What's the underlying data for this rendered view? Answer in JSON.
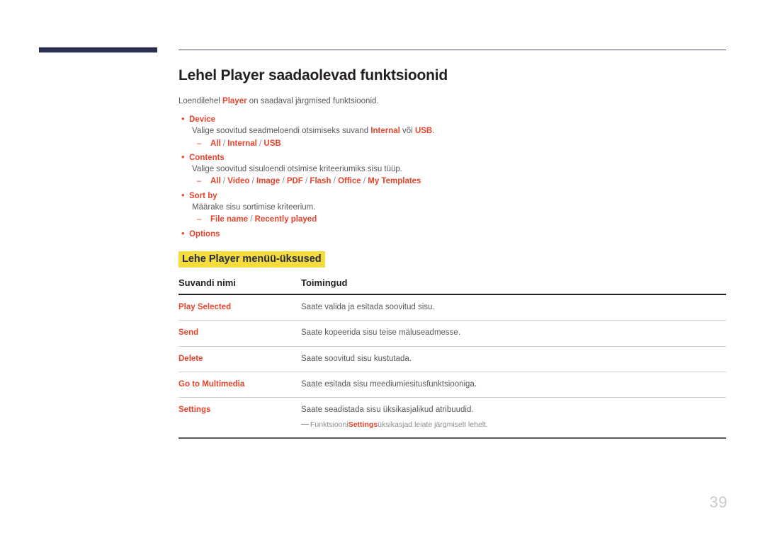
{
  "page": {
    "number": "39",
    "title": "Lehel Player saadaolevad funktsioonid",
    "intro_before": "Loendilehel ",
    "intro_highlight": "Player",
    "intro_after": " on saadaval järgmised funktsioonid."
  },
  "bullets": [
    {
      "label": "Device",
      "desc_before": "Valige soovitud seadmeloendi otsimiseks suvand ",
      "desc_hl1": "Internal",
      "desc_mid": " või ",
      "desc_hl2": "USB",
      "desc_after": ".",
      "options": "All / Internal / USB"
    },
    {
      "label": "Contents",
      "desc": "Valige soovitud sisuloendi otsimise kriteeriumiks sisu tüüp.",
      "options": "All / Video / Image / PDF / Flash / Office / My Templates"
    },
    {
      "label": "Sort by",
      "desc": "Määrake sisu sortimise kriteerium.",
      "options": "File name / Recently played"
    },
    {
      "label": "Options",
      "desc": "",
      "options": ""
    }
  ],
  "subheading": "Lehe Player menüü-üksused",
  "table": {
    "headers": [
      "Suvandi nimi",
      "Toimingud"
    ],
    "rows": [
      {
        "name": "Play Selected",
        "action": "Saate valida ja esitada soovitud sisu."
      },
      {
        "name": "Send",
        "action": "Saate kopeerida sisu teise mäluseadmesse."
      },
      {
        "name": "Delete",
        "action": "Saate soovitud sisu kustutada."
      },
      {
        "name": "Go to Multimedia",
        "action": "Saate esitada sisu meediumiesitusfunktsiooniga."
      },
      {
        "name": "Settings",
        "action": "Saate seadistada sisu üksikasjalikud atribuudid.",
        "note_before": "Funktsiooni ",
        "note_hl": "Settings",
        "note_after": " üksikasjad leiate järgmiselt lehelt."
      }
    ]
  },
  "colors": {
    "accent_red": "#e8432b",
    "highlight_yellow": "#f4dc3c",
    "navy": "#2b3050",
    "body_gray": "#58595b"
  }
}
